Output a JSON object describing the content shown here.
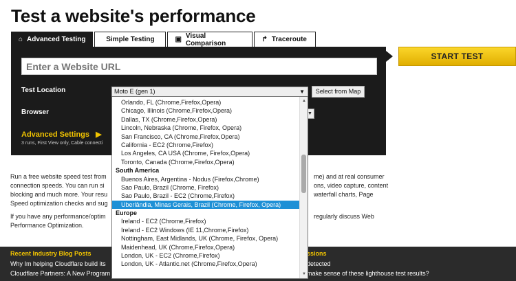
{
  "page": {
    "title": "Test a website's performance"
  },
  "tabs": [
    {
      "label": "Advanced Testing",
      "icon": "house-icon"
    },
    {
      "label": "Simple Testing",
      "icon": ""
    },
    {
      "label": "Visual Comparison",
      "icon": "image-icon"
    },
    {
      "label": "Traceroute",
      "icon": "route-icon"
    }
  ],
  "form": {
    "url_placeholder": "Enter a Website URL",
    "test_location_label": "Test Location",
    "test_location_value": "Moto E (gen 1)",
    "select_from_map": "Select from Map",
    "browser_label": "Browser",
    "advanced_settings": "Advanced Settings",
    "advanced_summary": "3 runs, First View only, Cable connecti"
  },
  "start_test": "START TEST",
  "description": {
    "line1": "Run a free website speed test from",
    "line1_right": "me) and at real consumer",
    "line2": "connection speeds. You can run si",
    "line2_right": "ons, video capture, content",
    "line3": "blocking and much more. Your resu",
    "line3_right": "waterfall charts, Page",
    "line4": "Speed optimization checks and sug",
    "line5": "If you have any performance/optim",
    "line5_right": "regularly discuss Web",
    "line6": "Performance Optimization."
  },
  "footer": {
    "blog_heading": "Recent Industry Blog Posts",
    "right_heading": "ssions",
    "blog_items": [
      "Why Im helping Cloudflare build its",
      "Cloudflare Partners: A New Program"
    ],
    "right_items": [
      "detected",
      "make sense of these lighthouse test results?"
    ]
  },
  "dropdown": {
    "options": [
      {
        "text": "Orlando, FL (Chrome,Firefox,Opera)",
        "type": "option"
      },
      {
        "text": "Chicago, Illinois (Chrome,Firefox,Opera)",
        "type": "option"
      },
      {
        "text": "Dallas, TX (Chrome,Firefox,Opera)",
        "type": "option"
      },
      {
        "text": "Lincoln, Nebraska (Chrome, Firefox, Opera)",
        "type": "option"
      },
      {
        "text": "San Francisco, CA (Chrome,Firefox,Opera)",
        "type": "option"
      },
      {
        "text": "California - EC2 (Chrome,Firefox)",
        "type": "option"
      },
      {
        "text": "Los Angeles, CA USA (Chrome, Firefox,Opera)",
        "type": "option"
      },
      {
        "text": "Toronto, Canada (Chrome,Firefox,Opera)",
        "type": "option"
      },
      {
        "text": "South America",
        "type": "group"
      },
      {
        "text": "Buenos Aires, Argentina - Nodus (Firefox,Chrome)",
        "type": "option"
      },
      {
        "text": "Sao Paulo, Brazil (Chrome, Firefox)",
        "type": "option"
      },
      {
        "text": "Sao Paulo, Brazil - EC2 (Chrome,Firefox)",
        "type": "option"
      },
      {
        "text": "Uberlândia, Minas Gerais, Brazil (Chrome, Firefox, Opera)",
        "type": "selected"
      },
      {
        "text": "Europe",
        "type": "group"
      },
      {
        "text": "Ireland - EC2 (Chrome,Firefox)",
        "type": "option"
      },
      {
        "text": "Ireland - EC2 Windows (IE 11,Chrome,Firefox)",
        "type": "option"
      },
      {
        "text": "Nottingham, East Midlands, UK (Chrome, Firefox, Opera)",
        "type": "option"
      },
      {
        "text": "Maidenhead, UK (Chrome,Firefox,Opera)",
        "type": "option"
      },
      {
        "text": "London, UK - EC2 (Chrome,Firefox)",
        "type": "option"
      },
      {
        "text": "London, UK - Atlantic.net (Chrome,Firefox,Opera)",
        "type": "option"
      }
    ]
  },
  "colors": {
    "panel_bg": "#1b1b1b",
    "accent_yellow": "#f2c400",
    "start_button": "#fbd62a",
    "footer_bg": "#2b2b2b",
    "selected_option": "#1e90d6"
  }
}
